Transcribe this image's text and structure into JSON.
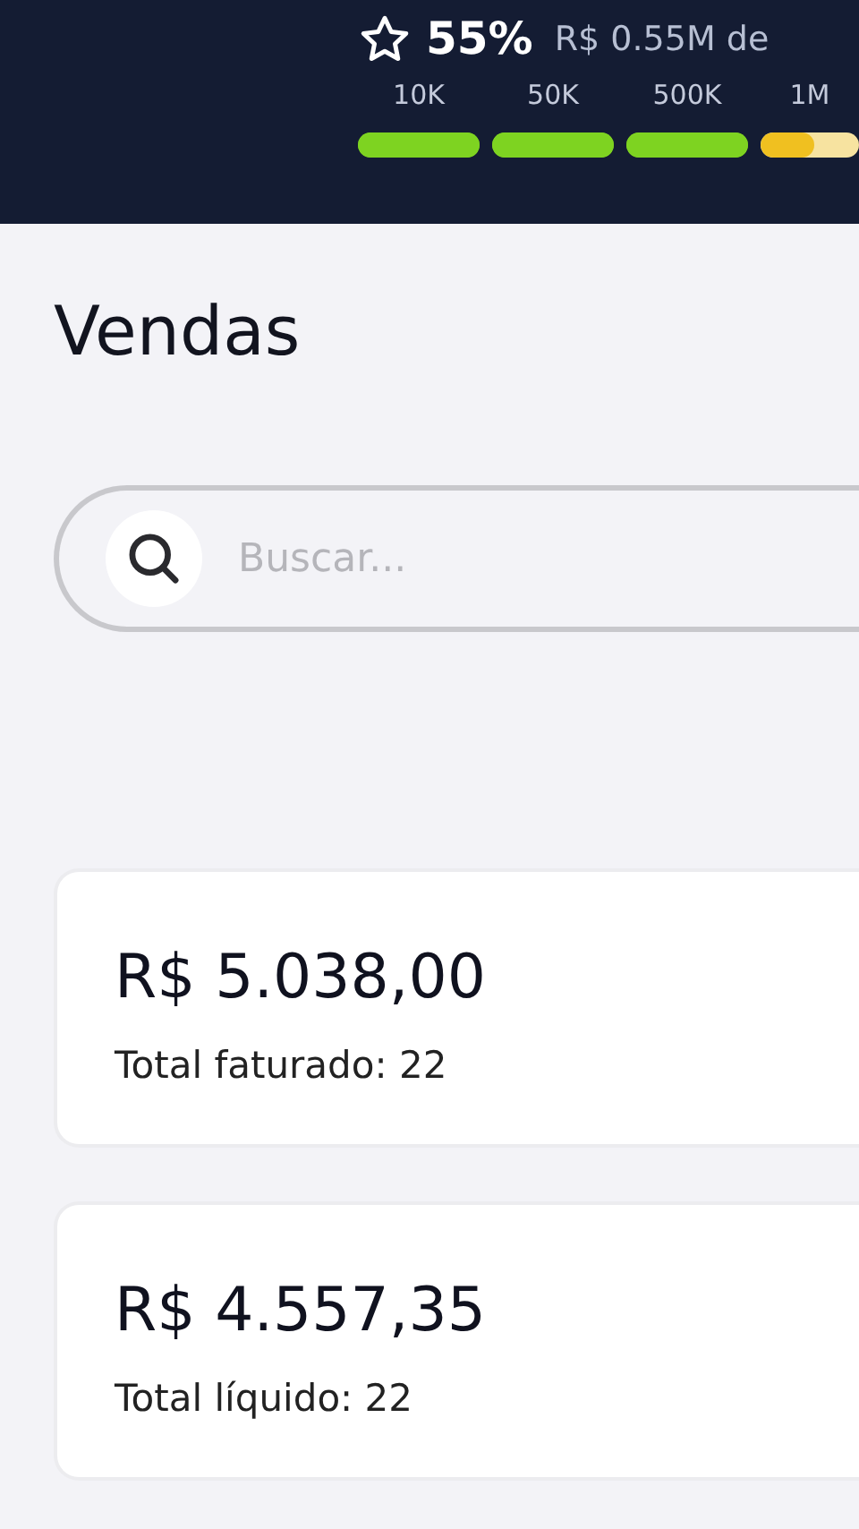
{
  "goal": {
    "percent": "55%",
    "amount": "R$ 0.55M de",
    "milestones": [
      {
        "label": "10K",
        "level": 1
      },
      {
        "label": "50K",
        "level": 1
      },
      {
        "label": "500K",
        "level": 1
      },
      {
        "label": "1M",
        "level": 0.55
      }
    ]
  },
  "page_title": "Vendas",
  "search": {
    "placeholder": "Buscar..."
  },
  "cards": [
    {
      "value": "R$ 5.038,00",
      "caption": "Total faturado: 22"
    },
    {
      "value": "R$ 4.557,35",
      "caption": "Total líquido: 22"
    }
  ]
}
